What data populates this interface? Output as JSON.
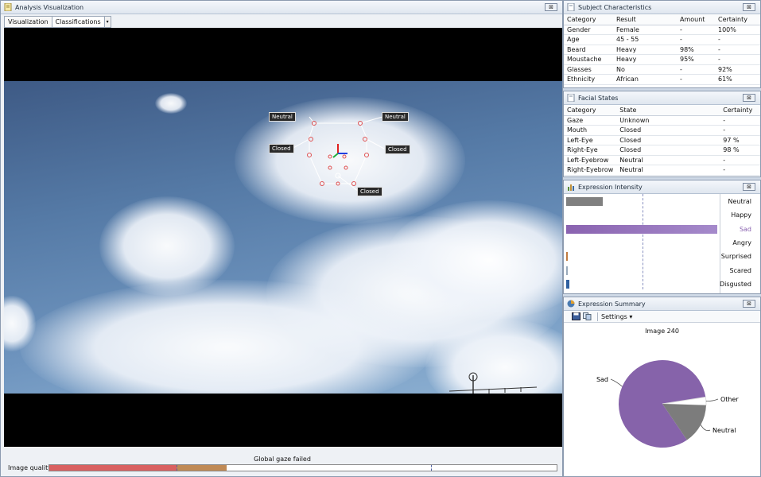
{
  "viz": {
    "title": "Analysis Visualization",
    "close": "⊠",
    "tabs": [
      "Visualization",
      "Classifications"
    ],
    "tab_dropdown": "▾",
    "face_labels": {
      "neutral_left": "Neutral",
      "neutral_right": "Neutral",
      "closed_left": "Closed",
      "closed_right": "Closed",
      "closed_bottom": "Closed"
    },
    "gaze_status": "Global gaze failed",
    "image_quality_label": "Image quality",
    "image_quality": {
      "primary_fraction": 0.25,
      "secondary_fraction": 0.1
    }
  },
  "subject": {
    "title": "Subject Characteristics",
    "columns": [
      "Category",
      "Result",
      "Amount",
      "Certainty"
    ],
    "rows": [
      [
        "Gender",
        "Female",
        "-",
        "100%"
      ],
      [
        "Age",
        "45 - 55",
        "-",
        "-"
      ],
      [
        "Beard",
        "Heavy",
        "98%",
        "-"
      ],
      [
        "Moustache",
        "Heavy",
        "95%",
        "-"
      ],
      [
        "Glasses",
        "No",
        "-",
        "92%"
      ],
      [
        "Ethnicity",
        "African",
        "-",
        "61%"
      ]
    ]
  },
  "facial": {
    "title": "Facial States",
    "columns": [
      "Category",
      "State",
      "Certainty"
    ],
    "rows": [
      [
        "Gaze",
        "Unknown",
        "-"
      ],
      [
        "Mouth",
        "Closed",
        "-"
      ],
      [
        "Left-Eye",
        "Closed",
        "97 %"
      ],
      [
        "Right-Eye",
        "Closed",
        "98 %"
      ],
      [
        "Left-Eyebrow",
        "Neutral",
        "-"
      ],
      [
        "Right-Eyebrow",
        "Neutral",
        "-"
      ]
    ]
  },
  "intensity": {
    "title": "Expression Intensity",
    "items": [
      {
        "label": "Neutral",
        "value": 0.24,
        "color": "#808080"
      },
      {
        "label": "Happy",
        "value": 0.0,
        "color": "#808080"
      },
      {
        "label": "Sad",
        "value": 1.0,
        "color": "#8a63b0",
        "highlight": true
      },
      {
        "label": "Angry",
        "value": 0.0,
        "color": "#808080"
      },
      {
        "label": "Surprised",
        "value": 0.01,
        "color": "#c07a40"
      },
      {
        "label": "Scared",
        "value": 0.005,
        "color": "#9ab"
      },
      {
        "label": "Disgusted",
        "value": 0.02,
        "color": "#3060a0"
      }
    ]
  },
  "summary": {
    "title": "Expression Summary",
    "settings": "Settings ▾",
    "chart_data": {
      "type": "pie",
      "title": "Image 240",
      "slices": [
        {
          "label": "Sad",
          "value": 0.82,
          "color": "#8663aa"
        },
        {
          "label": "Other",
          "value": 0.03,
          "color": "#ffffff"
        },
        {
          "label": "Neutral",
          "value": 0.15,
          "color": "#7c7c7c"
        }
      ]
    }
  }
}
